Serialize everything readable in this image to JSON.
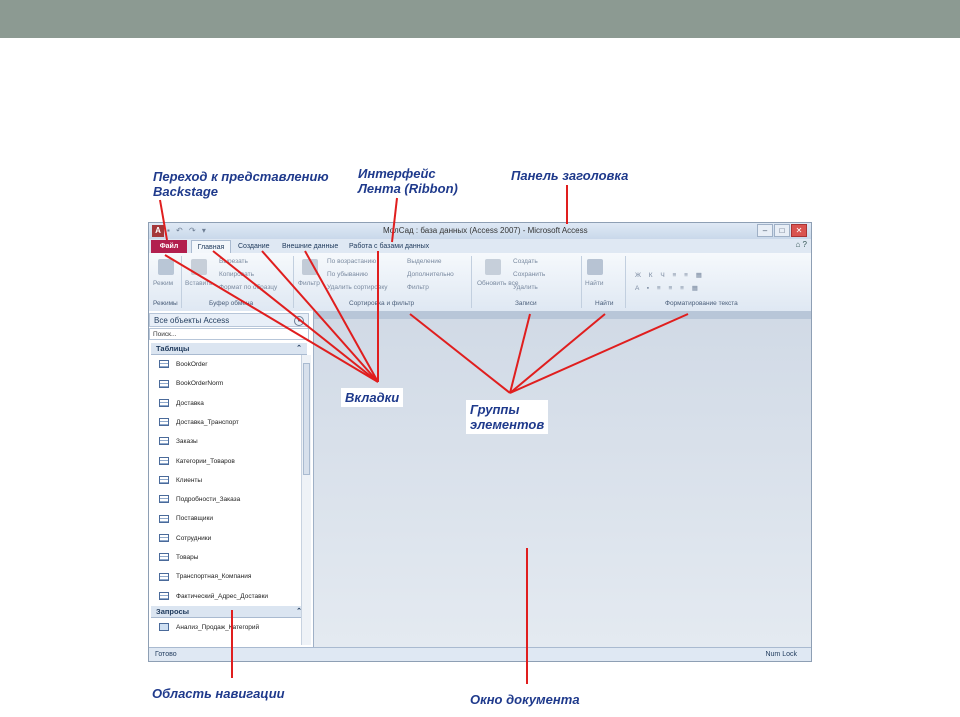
{
  "callouts": {
    "backstage": "Переход к представлению\nBackstage",
    "ribbon": "Интерфейс\nЛента (Ribbon)",
    "titlebar": "Панель заголовка",
    "tabs": "Вкладки",
    "groups": "Группы\nэлементов",
    "navpane": "Область навигации",
    "docwin": "Окно документа"
  },
  "window": {
    "title": "МолСад : база данных (Access 2007) - Microsoft Access",
    "tabs": [
      "Файл",
      "Главная",
      "Создание",
      "Внешние данные",
      "Работа с базами данных"
    ],
    "ribbon_groups": [
      "Режимы",
      "Буфер обмена",
      "Сортировка и фильтр",
      "Записи",
      "Найти",
      "Форматирование текста"
    ],
    "ribbon_commands": {
      "views": "Режим",
      "paste": "Вставить",
      "cut": "Вырезать",
      "copy": "Копировать",
      "format_painter": "Формат по образцу",
      "filter": "Фильтр",
      "ascending": "По возрастанию",
      "descending": "По убыванию",
      "remove_sort": "Удалить сортировку",
      "selection": "Выделение",
      "advanced": "Дополнительно",
      "toggle_filter": "Фильтр",
      "refresh_all": "Обновить все",
      "new": "Создать",
      "save": "Сохранить",
      "delete": "Удалить",
      "find": "Найти"
    },
    "nav": {
      "header": "Все объекты Access",
      "search_placeholder": "Поиск...",
      "tables_label": "Таблицы",
      "tables": [
        "BookOrder",
        "BookOrderNorm",
        "Доставка",
        "Доставка_Транспорт",
        "Заказы",
        "Категории_Товаров",
        "Клиенты",
        "Подробности_Заказа",
        "Поставщики",
        "Сотрудники",
        "Товары",
        "Транспортная_Компания",
        "Фактический_Адрес_Доставки"
      ],
      "queries_label": "Запросы",
      "queries": [
        "Анализ_Продаж_Категорий"
      ]
    },
    "status": {
      "left": "Готово",
      "right": "Num Lock"
    }
  },
  "colors": {
    "callout": "#1f3a8c",
    "arrow": "#e01e1e",
    "file_tab": "#b21f4e",
    "top_band": "#8c9a92"
  }
}
